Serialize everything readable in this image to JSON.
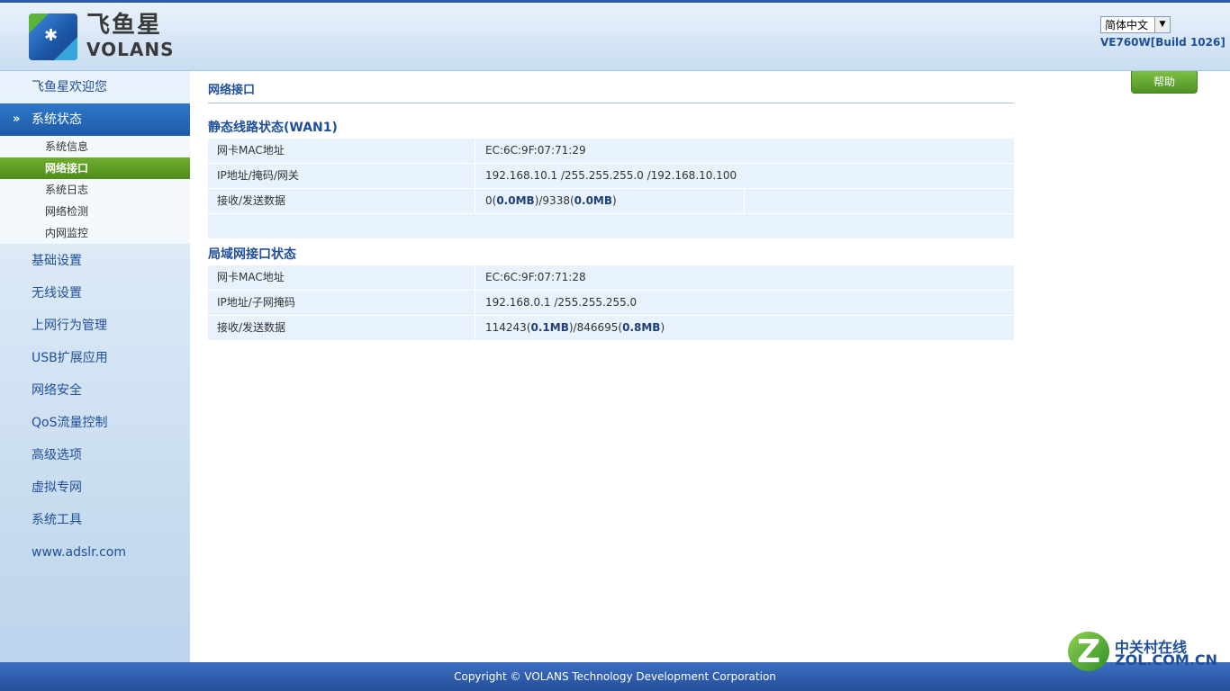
{
  "header": {
    "logo_cn": "飞鱼星",
    "logo_en": "VOLANS",
    "language_select": "简体中文",
    "version": "VE760W[Build 1026]"
  },
  "sidebar": {
    "welcome": "飞鱼星欢迎您",
    "active_section": "系统状态",
    "sub_items": [
      "系统信息",
      "网络接口",
      "系统日志",
      "网络检测",
      "内网监控"
    ],
    "selected_sub": "网络接口",
    "items": [
      "基础设置",
      "无线设置",
      "上网行为管理",
      "USB扩展应用",
      "网络安全",
      "QoS流量控制",
      "高级选项",
      "虚拟专网",
      "系统工具",
      "www.adslr.com"
    ]
  },
  "main": {
    "title": "网络接口",
    "help_label": "帮助",
    "wan": {
      "heading": "静态线路状态(WAN1)",
      "rows": [
        {
          "label": "网卡MAC地址",
          "value": "EC:6C:9F:07:71:29"
        },
        {
          "label": "IP地址/掩码/网关",
          "value": "192.168.10.1 /255.255.255.0 /192.168.10.100"
        },
        {
          "label": "接收/发送数据",
          "rx_bytes": "0",
          "rx_mb": "0.0MB",
          "tx_bytes": "9338",
          "tx_mb": "0.0MB"
        }
      ]
    },
    "lan": {
      "heading": "局域网接口状态",
      "rows": [
        {
          "label": "网卡MAC地址",
          "value": "EC:6C:9F:07:71:28"
        },
        {
          "label": "IP地址/子网掩码",
          "value": "192.168.0.1 /255.255.255.0"
        },
        {
          "label": "接收/发送数据",
          "rx_bytes": "114243",
          "rx_mb": "0.1MB",
          "tx_bytes": "846695",
          "tx_mb": "0.8MB"
        }
      ]
    }
  },
  "footer": {
    "copyright": "Copyright © VOLANS Technology Development Corporation"
  },
  "watermark": {
    "line1": "中关村在线",
    "line2": "ZOL.COM.CN"
  }
}
